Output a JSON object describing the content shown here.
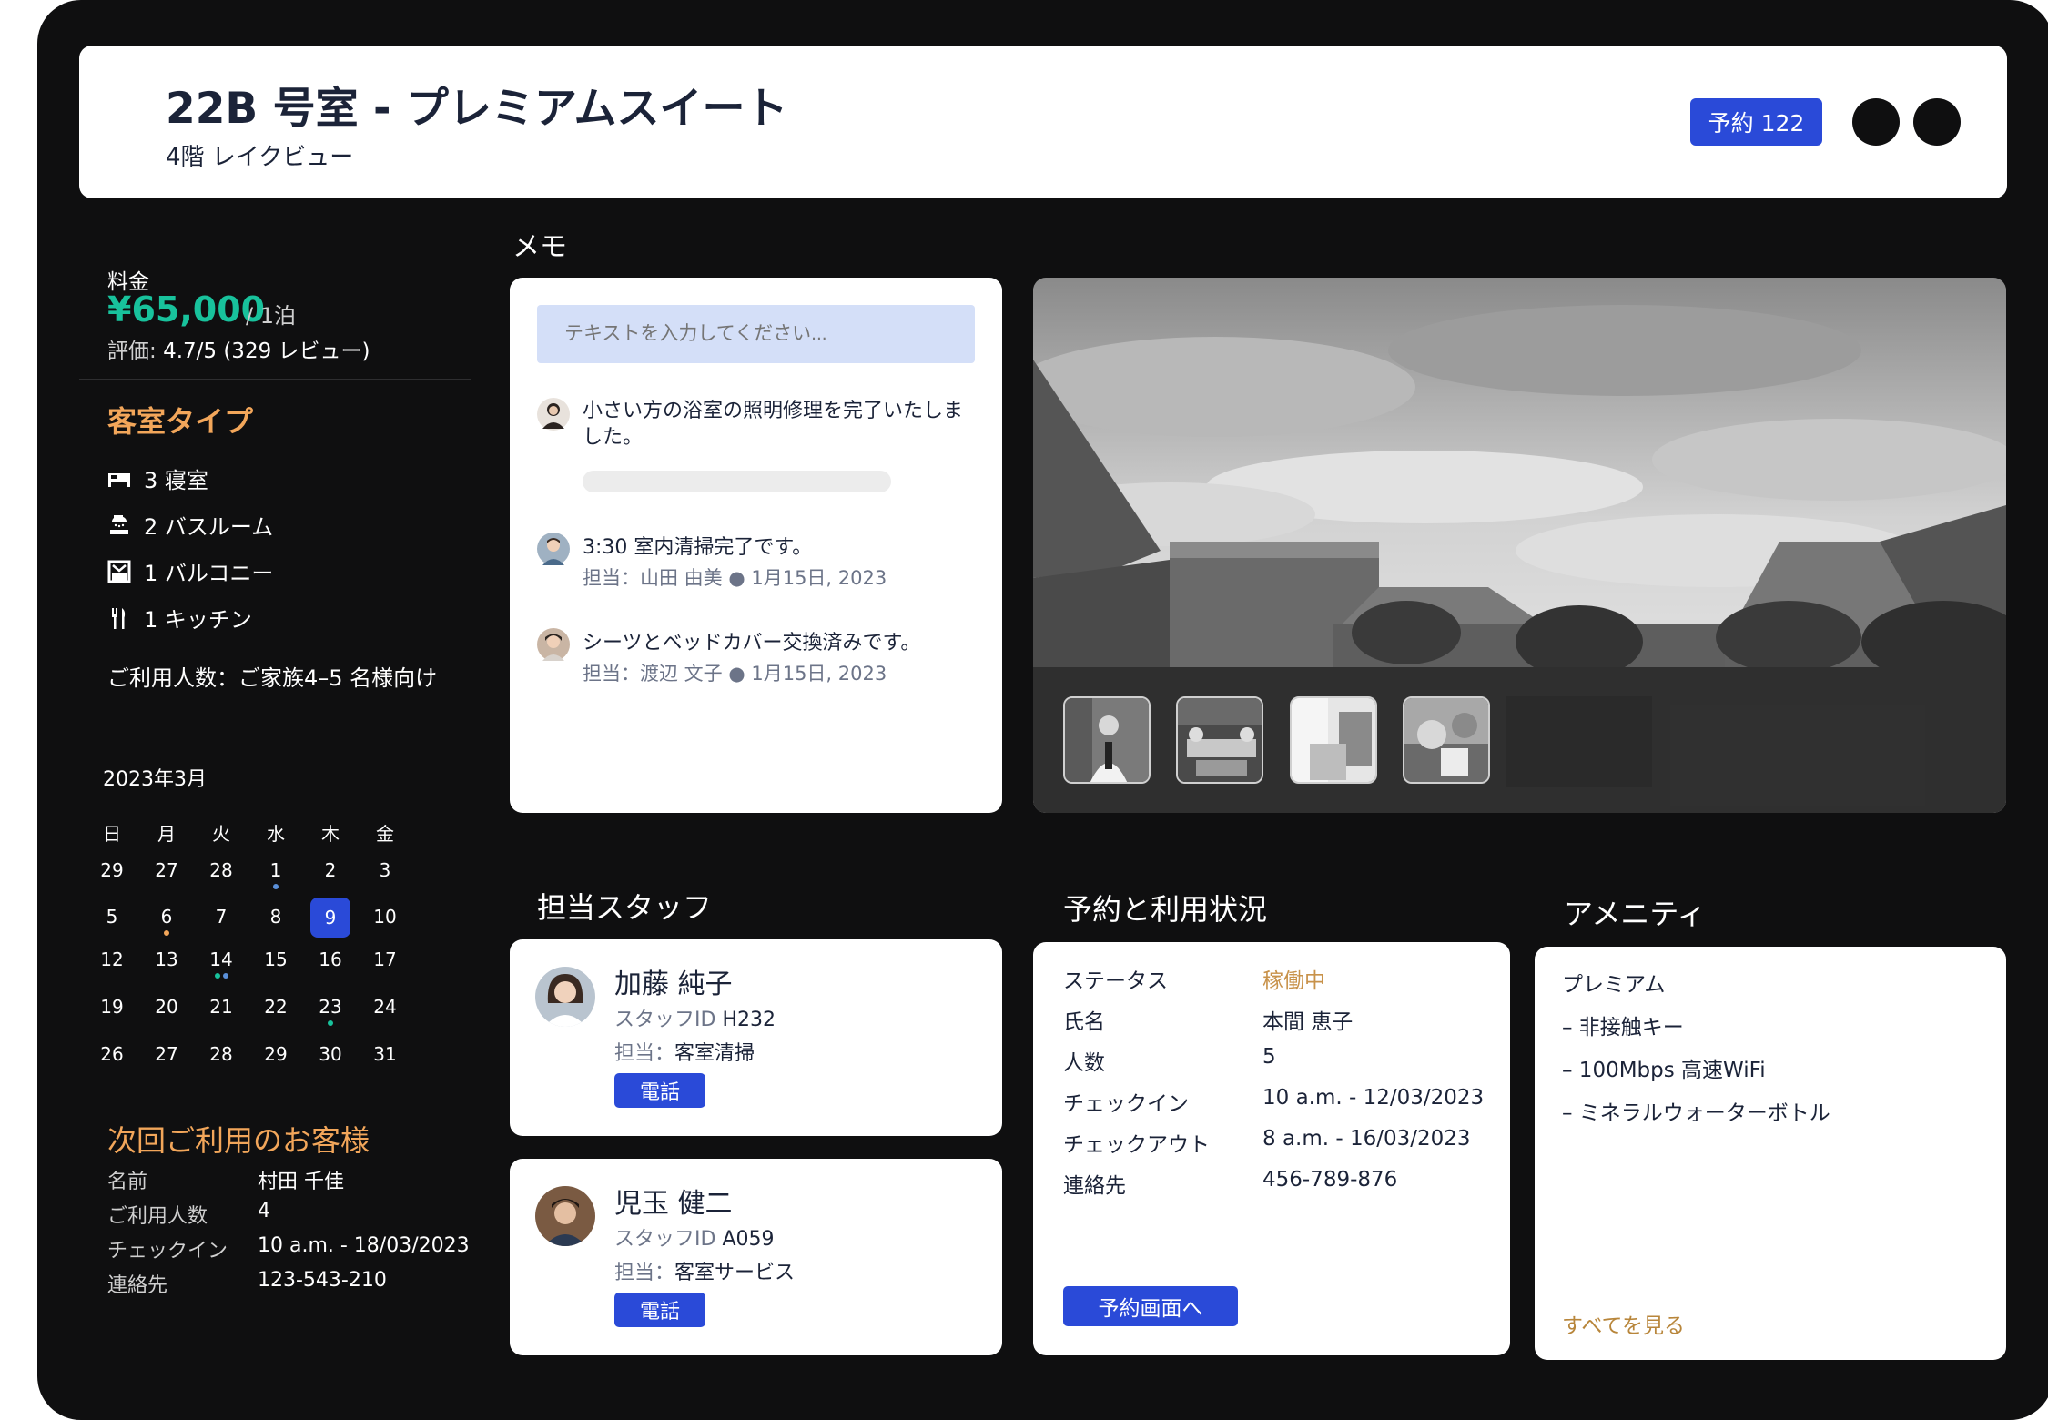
{
  "header": {
    "room_title": "22B 号室 - プレミアムスイート",
    "room_subtitle": "4階 レイクビュー",
    "booking_badge": "予約 122"
  },
  "pricing": {
    "label": "料金",
    "value": "¥65,000",
    "unit": "/ 1泊",
    "rating_label": "評価:",
    "rating_value": "4.7/5 (329 レビュー)"
  },
  "room_type": {
    "title": "客室タイプ",
    "features": [
      {
        "icon": "bed-icon",
        "label": "3 寝室"
      },
      {
        "icon": "shower-icon",
        "label": "2 バスルーム"
      },
      {
        "icon": "balcony-icon",
        "label": "1 バルコニー"
      },
      {
        "icon": "kitchen-icon",
        "label": "1 キッチン"
      }
    ],
    "capacity": "ご利用人数：ご家族4–5 名様向け"
  },
  "calendar": {
    "month": "2023年3月",
    "weekdays": [
      "日",
      "月",
      "火",
      "水",
      "木",
      "金"
    ],
    "weeks": [
      [
        "29",
        "27",
        "28",
        "1",
        "2",
        "3"
      ],
      [
        "5",
        "6",
        "7",
        "8",
        "9",
        "10"
      ],
      [
        "12",
        "13",
        "14",
        "15",
        "16",
        "17"
      ],
      [
        "19",
        "20",
        "21",
        "22",
        "23",
        "24"
      ],
      [
        "26",
        "27",
        "28",
        "29",
        "30",
        "31"
      ]
    ],
    "selected": "9"
  },
  "next_guest": {
    "title": "次回ご利用のお客様",
    "rows": [
      {
        "key": "名前",
        "value": "村田 千佳"
      },
      {
        "key": "ご利用人数",
        "value": "4"
      },
      {
        "key": "チェックイン",
        "value": "10 a.m. - 18/03/2023"
      },
      {
        "key": "連絡先",
        "value": "123-543-210"
      }
    ]
  },
  "memo": {
    "heading": "メモ",
    "placeholder": "テキストを入力してください...",
    "notes": [
      {
        "text": "小さい方の浴室の照明修理を完了いたしました。"
      },
      {
        "text": "3:30 室内清掃完了です。",
        "meta": "担当：山田 由美 ● 1月15日, 2023"
      },
      {
        "text": "シーツとベッドカバー交換済みです。",
        "meta": "担当：渡辺 文子 ● 1月15日, 2023"
      }
    ]
  },
  "staff": {
    "heading": "担当スタッフ",
    "members": [
      {
        "name": "加藤 純子",
        "id_label": "スタッフID",
        "id": "H232",
        "role_label": "担当：",
        "role": "客室清掃",
        "call": "電話"
      },
      {
        "name": "児玉 健二",
        "id_label": "スタッフID",
        "id": "A059",
        "role_label": "担当：",
        "role": "客室サービス",
        "call": "電話"
      }
    ]
  },
  "reservation": {
    "heading": "予約と利用状況",
    "rows": [
      {
        "key": "ステータス",
        "value": "稼働中"
      },
      {
        "key": "氏名",
        "value": "本間 恵子"
      },
      {
        "key": "人数",
        "value": "5"
      },
      {
        "key": "チェックイン",
        "value": "10 a.m. - 12/03/2023"
      },
      {
        "key": "チェックアウト",
        "value": "8 a.m. - 16/03/2023"
      },
      {
        "key": "連絡先",
        "value": "456-789-876"
      }
    ],
    "button": "予約画面へ"
  },
  "amenities": {
    "heading": "アメニティ",
    "lines": [
      "プレミアム",
      "– 非接触キー",
      "– 100Mbps 高速WiFi",
      "– ミネラルウォーターボトル"
    ],
    "see_all": "すべてを見る"
  },
  "colors": {
    "accent": "#2a4ad8",
    "price": "#18c29c",
    "gold": "#f2a65a",
    "status": "#c8924a",
    "background": "#0f0f10"
  }
}
